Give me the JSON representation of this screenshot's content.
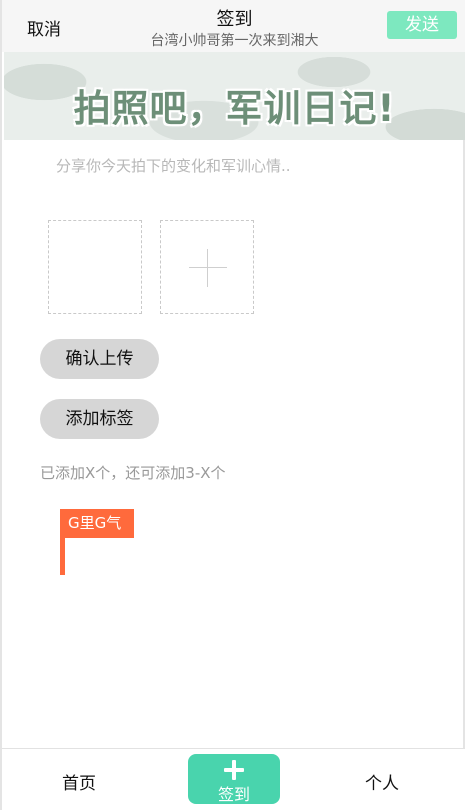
{
  "header": {
    "cancel_label": "取消",
    "title": "签到",
    "subtitle": "台湾小帅哥第一次来到湘大",
    "send_label": "发送",
    "send_color": "#7de8bf"
  },
  "banner": {
    "text": "拍照吧，军训日记!"
  },
  "compose": {
    "placeholder": "分享你今天拍下的变化和军训心情.."
  },
  "photos": {
    "add_icon": "plus-icon"
  },
  "actions": {
    "confirm_upload_label": "确认上传",
    "add_tag_label": "添加标签"
  },
  "tags": {
    "count_text": "已添加X个，还可添加3-X个",
    "items": [
      {
        "label": "G里G气",
        "color": "#ff6a3c"
      }
    ]
  },
  "bottom_nav": {
    "home_label": "首页",
    "checkin_label": "签到",
    "checkin_icon": "plus-icon",
    "checkin_color": "#49d4ad",
    "me_label": "个人"
  }
}
